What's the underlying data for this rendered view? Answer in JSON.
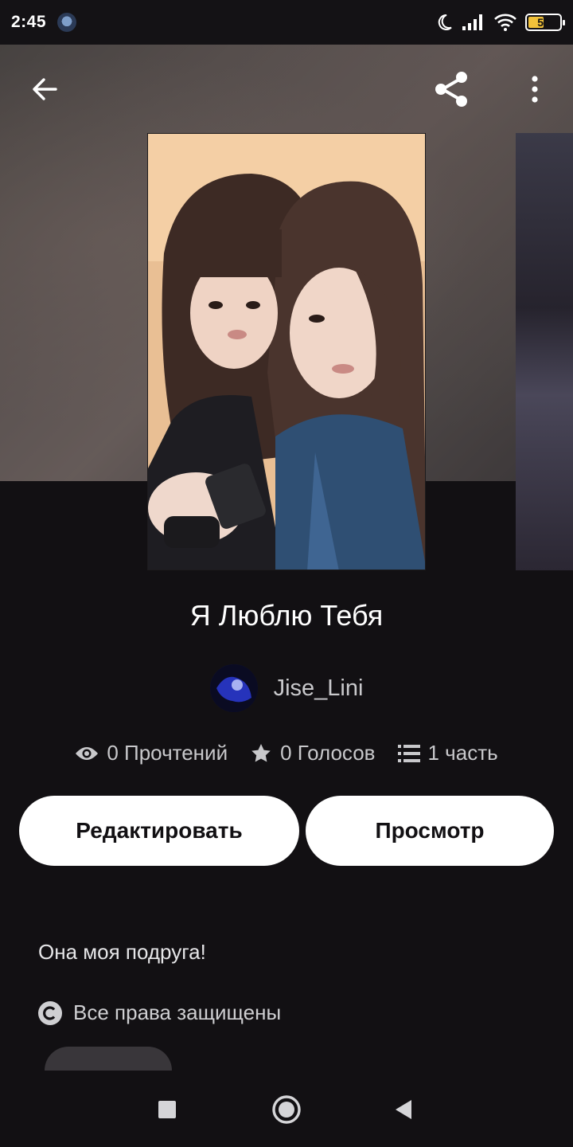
{
  "status_bar": {
    "time": "2:45",
    "battery": "50",
    "icons": [
      "notification-app-icon",
      "moon-icon",
      "signal-icon",
      "wifi-icon",
      "battery-icon"
    ]
  },
  "toolbar": {
    "back_icon": "arrow-left-icon",
    "share_icon": "share-icon",
    "more_icon": "more-vertical-icon"
  },
  "story": {
    "title": "Я Люблю Тебя",
    "author": "Jise_Lini",
    "stats": {
      "reads": "0 Прочтений",
      "votes": "0 Голосов",
      "parts": "1 часть"
    },
    "description": "Она моя подруга!",
    "copyright": "Все права защищены"
  },
  "actions": {
    "edit_label": "Редактировать",
    "view_label": "Просмотр"
  },
  "colors": {
    "background": "#121013",
    "button_bg": "#ffffff",
    "button_text": "#121013",
    "muted_text": "#c8c8cb"
  }
}
